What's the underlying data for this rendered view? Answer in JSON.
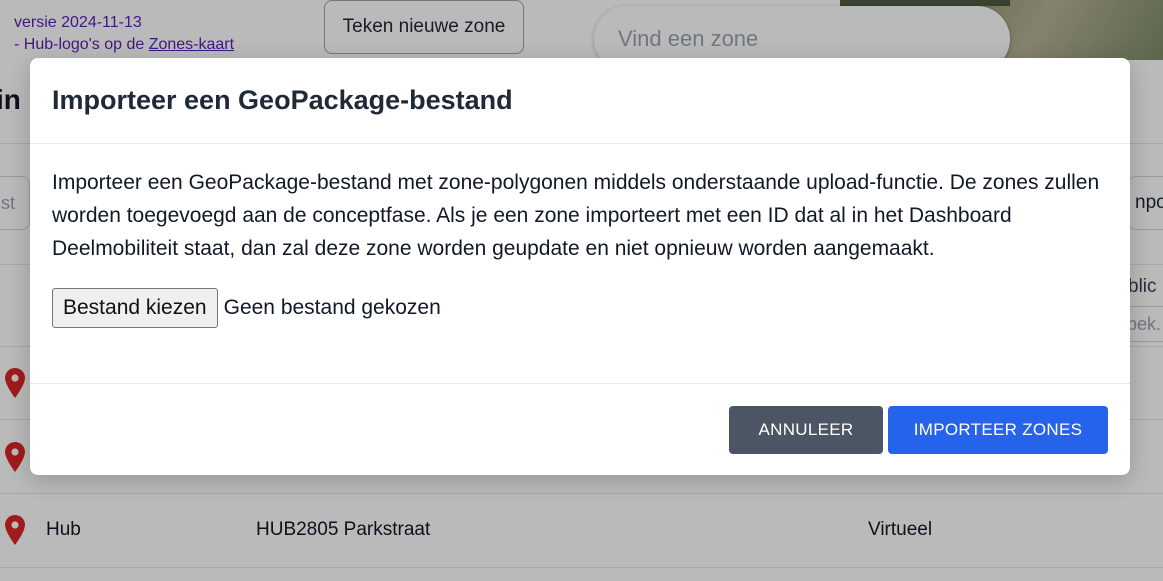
{
  "background": {
    "version_line": "versie 2024-11-13",
    "changelog_prefix": "- Hub-logo's op de ",
    "changelog_link": "Zones-kaart",
    "draw_zone_button": "Teken nieuwe zone",
    "search_placeholder": "Vind een zone",
    "side_title_fragment": "in",
    "left_input_fragment": "st",
    "right_button_fragment": "npor",
    "right_text_fragment": "blic",
    "right_input_fragment": "bek.",
    "visible_row": {
      "type": "Hub",
      "name": "HUB2805 Parkstraat",
      "phase": "Virtueel"
    }
  },
  "modal": {
    "title": "Importeer een GeoPackage-bestand",
    "description": "Importeer een GeoPackage-bestand met zone-polygonen middels onderstaande upload-functie. De zones zullen worden toegevoegd aan de conceptfase. Als je een zone importeert met een ID dat al in het Dashboard Deelmobiliteit staat, dan zal deze zone worden geupdate en niet opnieuw worden aangemaakt.",
    "file_button": "Bestand kiezen",
    "file_status": "Geen bestand gekozen",
    "cancel_button": "ANNULEER",
    "import_button": "IMPORTEER ZONES"
  },
  "colors": {
    "primary": "#2563eb",
    "secondary": "#4b5563",
    "pin": "#dc2626",
    "link": "#5b21b6"
  },
  "icons": {
    "row_marker": "map-pin-icon"
  }
}
